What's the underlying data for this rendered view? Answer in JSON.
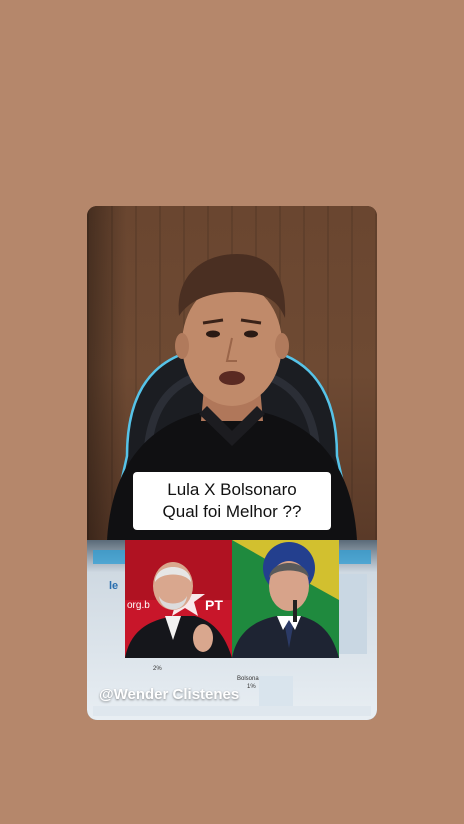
{
  "caption": {
    "line1": "Lula X Bolsonaro",
    "line2": "Qual foi Melhor ??"
  },
  "screen": {
    "logo": "le",
    "party_text": "org.b",
    "party_initials": "PT",
    "stat_left": "2%",
    "stat_right_label": "Bolsonaro",
    "stat_right_value": "1%"
  },
  "watermark": "@Wender Clistenes",
  "colors": {
    "background": "#b5876b",
    "caption_bg": "#ffffff",
    "caption_text": "#111111",
    "pt_red": "#c8162a",
    "brazil_green": "#1f8a3e",
    "brazil_yellow": "#f2c92d"
  }
}
